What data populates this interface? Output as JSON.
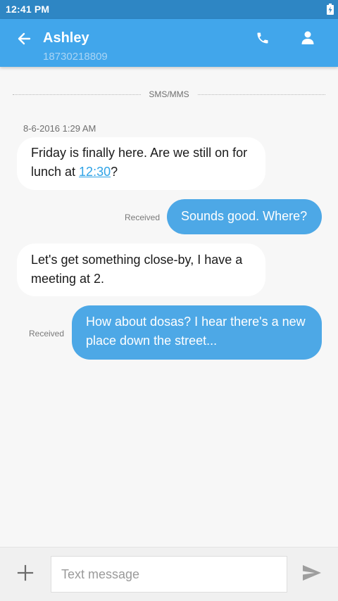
{
  "status_bar": {
    "time": "12:41 PM",
    "battery_icon": "battery-charging-icon"
  },
  "header": {
    "back_icon": "arrow-left-icon",
    "contact_name": "Ashley",
    "contact_number": "18730218809",
    "call_icon": "phone-icon",
    "contact_icon": "person-icon"
  },
  "conversation": {
    "divider_label": "SMS/MMS",
    "timestamp": "8-6-2016 1:29 AM",
    "messages": [
      {
        "direction": "incoming",
        "text_before_link": "Friday is finally here. Are we still on for lunch at ",
        "link_text": "12:30",
        "text_after_link": "?"
      },
      {
        "direction": "outgoing",
        "status": "Received",
        "text": "Sounds good. Where?"
      },
      {
        "direction": "incoming",
        "text": "Let's get something close-by, I have a meeting at 2."
      },
      {
        "direction": "outgoing",
        "status": "Received",
        "text": "How about dosas? I hear there's a new place down the street..."
      }
    ]
  },
  "compose": {
    "attach_icon": "plus-icon",
    "placeholder": "Text message",
    "value": "",
    "send_icon": "send-icon"
  },
  "colors": {
    "status_bar": "#2e86c4",
    "app_bar": "#41a6eb",
    "outgoing_bubble": "#4da8e6",
    "incoming_bubble": "#ffffff",
    "link": "#2fa3e6",
    "background": "#f7f7f7"
  }
}
